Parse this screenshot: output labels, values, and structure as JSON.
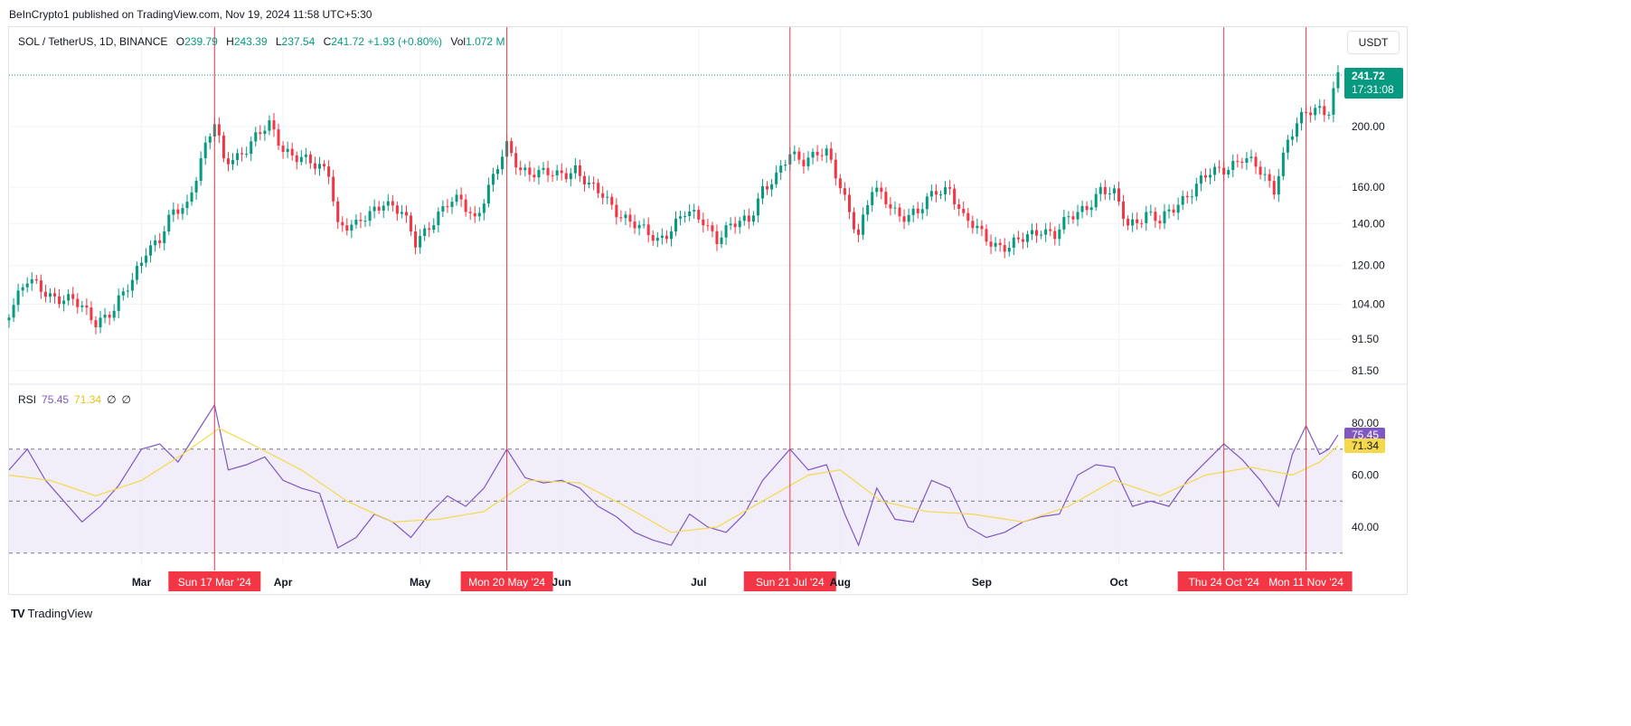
{
  "header": {
    "published_text": "BeInCrypto1 published on TradingView.com, Nov 19, 2024 11:58 UTC+5:30"
  },
  "legend": {
    "symbol": "SOL / TetherUS, 1D, BINANCE",
    "o_label": "O",
    "o": "239.79",
    "h_label": "H",
    "h": "243.39",
    "l_label": "L",
    "l": "237.54",
    "c_label": "C",
    "c": "241.72",
    "change": "+1.93 (+0.80%)",
    "vol_label": "Vol",
    "vol": "1.072 M"
  },
  "currency": "USDT",
  "last_price": {
    "price": "241.72",
    "countdown": "17:31:08"
  },
  "rsi_legend": {
    "label": "RSI",
    "rsi": "75.45",
    "ma": "71.34",
    "x1": "∅",
    "x2": "∅"
  },
  "rsi_tags": {
    "rsi": "75.45",
    "ma": "71.34"
  },
  "footer": {
    "brand": "TradingView"
  },
  "colors": {
    "up": "#089981",
    "down": "#f23645",
    "rsi": "#7e57c2",
    "rsi_ma": "#f5d84b",
    "marker": "#f23645",
    "band": "#ede7f6"
  },
  "chart_data": [
    {
      "type": "candlestick",
      "title": "SOL / TetherUS, 1D, BINANCE",
      "y_scale": "log",
      "y_ticks": [
        81.5,
        91.5,
        104.0,
        120.0,
        140.0,
        160.0,
        200.0
      ],
      "y_tick_labels": [
        "81.50",
        "91.50",
        "104.00",
        "120.00",
        "140.00",
        "160.00",
        "200.00"
      ],
      "x_tick_labels": [
        "Mar",
        "Apr",
        "May",
        "Jun",
        "Jul",
        "Aug",
        "Sep",
        "Oct"
      ],
      "x_ticks": [
        "2024-03-01",
        "2024-04-01",
        "2024-05-01",
        "2024-06-01",
        "2024-07-01",
        "2024-08-01",
        "2024-09-01",
        "2024-10-01"
      ],
      "last_price": 241.72,
      "close_path": [
        [
          "2024-02-01",
          102
        ],
        [
          "2024-02-05",
          113
        ],
        [
          "2024-02-10",
          108
        ],
        [
          "2024-02-15",
          105
        ],
        [
          "2024-02-20",
          98
        ],
        [
          "2024-02-24",
          102
        ],
        [
          "2024-02-28",
          113
        ],
        [
          "2024-03-02",
          128
        ],
        [
          "2024-03-05",
          132
        ],
        [
          "2024-03-08",
          145
        ],
        [
          "2024-03-11",
          150
        ],
        [
          "2024-03-14",
          178
        ],
        [
          "2024-03-17",
          202
        ],
        [
          "2024-03-19",
          175
        ],
        [
          "2024-03-22",
          180
        ],
        [
          "2024-03-26",
          192
        ],
        [
          "2024-03-29",
          200
        ],
        [
          "2024-04-01",
          185
        ],
        [
          "2024-04-05",
          178
        ],
        [
          "2024-04-08",
          172
        ],
        [
          "2024-04-11",
          170
        ],
        [
          "2024-04-13",
          140
        ],
        [
          "2024-04-17",
          138
        ],
        [
          "2024-04-20",
          145
        ],
        [
          "2024-04-23",
          153
        ],
        [
          "2024-04-27",
          145
        ],
        [
          "2024-04-30",
          130
        ],
        [
          "2024-05-03",
          140
        ],
        [
          "2024-05-07",
          150
        ],
        [
          "2024-05-10",
          152
        ],
        [
          "2024-05-13",
          143
        ],
        [
          "2024-05-17",
          165
        ],
        [
          "2024-05-20",
          185
        ],
        [
          "2024-05-23",
          172
        ],
        [
          "2024-05-27",
          168
        ],
        [
          "2024-05-31",
          167
        ],
        [
          "2024-06-04",
          172
        ],
        [
          "2024-06-07",
          160
        ],
        [
          "2024-06-10",
          155
        ],
        [
          "2024-06-14",
          145
        ],
        [
          "2024-06-18",
          137
        ],
        [
          "2024-06-22",
          132
        ],
        [
          "2024-06-25",
          138
        ],
        [
          "2024-06-28",
          145
        ],
        [
          "2024-07-02",
          142
        ],
        [
          "2024-07-05",
          133
        ],
        [
          "2024-07-08",
          138
        ],
        [
          "2024-07-12",
          142
        ],
        [
          "2024-07-15",
          160
        ],
        [
          "2024-07-18",
          165
        ],
        [
          "2024-07-21",
          180
        ],
        [
          "2024-07-24",
          178
        ],
        [
          "2024-07-27",
          182
        ],
        [
          "2024-07-29",
          180
        ],
        [
          "2024-08-01",
          160
        ],
        [
          "2024-08-05",
          135
        ],
        [
          "2024-08-08",
          158
        ],
        [
          "2024-08-11",
          152
        ],
        [
          "2024-08-14",
          145
        ],
        [
          "2024-08-18",
          145
        ],
        [
          "2024-08-22",
          158
        ],
        [
          "2024-08-25",
          160
        ],
        [
          "2024-08-28",
          142
        ],
        [
          "2024-09-01",
          135
        ],
        [
          "2024-09-04",
          130
        ],
        [
          "2024-09-07",
          128
        ],
        [
          "2024-09-10",
          132
        ],
        [
          "2024-09-14",
          138
        ],
        [
          "2024-09-17",
          134
        ],
        [
          "2024-09-20",
          142
        ],
        [
          "2024-09-24",
          150
        ],
        [
          "2024-09-27",
          158
        ],
        [
          "2024-09-30",
          155
        ],
        [
          "2024-10-03",
          140
        ],
        [
          "2024-10-07",
          145
        ],
        [
          "2024-10-10",
          140
        ],
        [
          "2024-10-14",
          152
        ],
        [
          "2024-10-17",
          158
        ],
        [
          "2024-10-21",
          168
        ],
        [
          "2024-10-24",
          172
        ],
        [
          "2024-10-28",
          178
        ],
        [
          "2024-10-31",
          172
        ],
        [
          "2024-11-04",
          160
        ],
        [
          "2024-11-07",
          190
        ],
        [
          "2024-11-11",
          210
        ],
        [
          "2024-11-14",
          215
        ],
        [
          "2024-11-16",
          213
        ],
        [
          "2024-11-18",
          241.72
        ]
      ]
    },
    {
      "type": "line",
      "title": "RSI",
      "y_ticks": [
        40,
        60,
        80
      ],
      "y_tick_labels": [
        "40.00",
        "60.00",
        "80.00"
      ],
      "bands": [
        30,
        50,
        70
      ],
      "series": [
        {
          "name": "RSI",
          "last": 75.45,
          "values": [
            [
              "2024-02-01",
              62
            ],
            [
              "2024-02-05",
              70
            ],
            [
              "2024-02-09",
              58
            ],
            [
              "2024-02-13",
              50
            ],
            [
              "2024-02-17",
              42
            ],
            [
              "2024-02-21",
              48
            ],
            [
              "2024-02-25",
              56
            ],
            [
              "2024-03-01",
              70
            ],
            [
              "2024-03-05",
              72
            ],
            [
              "2024-03-09",
              65
            ],
            [
              "2024-03-13",
              76
            ],
            [
              "2024-03-17",
              87
            ],
            [
              "2024-03-20",
              62
            ],
            [
              "2024-03-24",
              64
            ],
            [
              "2024-03-28",
              67
            ],
            [
              "2024-04-01",
              58
            ],
            [
              "2024-04-05",
              55
            ],
            [
              "2024-04-09",
              53
            ],
            [
              "2024-04-13",
              32
            ],
            [
              "2024-04-17",
              36
            ],
            [
              "2024-04-21",
              45
            ],
            [
              "2024-04-25",
              42
            ],
            [
              "2024-04-29",
              36
            ],
            [
              "2024-05-03",
              45
            ],
            [
              "2024-05-07",
              52
            ],
            [
              "2024-05-11",
              48
            ],
            [
              "2024-05-15",
              55
            ],
            [
              "2024-05-20",
              70
            ],
            [
              "2024-05-24",
              59
            ],
            [
              "2024-05-28",
              57
            ],
            [
              "2024-06-01",
              58
            ],
            [
              "2024-06-05",
              55
            ],
            [
              "2024-06-09",
              48
            ],
            [
              "2024-06-13",
              44
            ],
            [
              "2024-06-17",
              38
            ],
            [
              "2024-06-21",
              35
            ],
            [
              "2024-06-25",
              33
            ],
            [
              "2024-06-29",
              45
            ],
            [
              "2024-07-03",
              40
            ],
            [
              "2024-07-07",
              38
            ],
            [
              "2024-07-11",
              45
            ],
            [
              "2024-07-15",
              58
            ],
            [
              "2024-07-21",
              70
            ],
            [
              "2024-07-25",
              62
            ],
            [
              "2024-07-29",
              64
            ],
            [
              "2024-08-02",
              45
            ],
            [
              "2024-08-05",
              33
            ],
            [
              "2024-08-09",
              55
            ],
            [
              "2024-08-13",
              43
            ],
            [
              "2024-08-17",
              42
            ],
            [
              "2024-08-21",
              58
            ],
            [
              "2024-08-25",
              55
            ],
            [
              "2024-08-29",
              40
            ],
            [
              "2024-09-02",
              36
            ],
            [
              "2024-09-06",
              38
            ],
            [
              "2024-09-10",
              42
            ],
            [
              "2024-09-14",
              44
            ],
            [
              "2024-09-18",
              45
            ],
            [
              "2024-09-22",
              60
            ],
            [
              "2024-09-26",
              64
            ],
            [
              "2024-09-30",
              63
            ],
            [
              "2024-10-04",
              48
            ],
            [
              "2024-10-08",
              50
            ],
            [
              "2024-10-12",
              48
            ],
            [
              "2024-10-16",
              58
            ],
            [
              "2024-10-20",
              65
            ],
            [
              "2024-10-24",
              72
            ],
            [
              "2024-10-28",
              66
            ],
            [
              "2024-11-01",
              58
            ],
            [
              "2024-11-05",
              48
            ],
            [
              "2024-11-08",
              68
            ],
            [
              "2024-11-11",
              79
            ],
            [
              "2024-11-14",
              68
            ],
            [
              "2024-11-16",
              70
            ],
            [
              "2024-11-18",
              75.45
            ]
          ]
        },
        {
          "name": "RSI-based MA",
          "last": 71.34,
          "values": [
            [
              "2024-02-01",
              60
            ],
            [
              "2024-02-10",
              58
            ],
            [
              "2024-02-20",
              52
            ],
            [
              "2024-03-01",
              58
            ],
            [
              "2024-03-10",
              68
            ],
            [
              "2024-03-18",
              78
            ],
            [
              "2024-03-25",
              72
            ],
            [
              "2024-04-05",
              62
            ],
            [
              "2024-04-15",
              50
            ],
            [
              "2024-04-25",
              42
            ],
            [
              "2024-05-05",
              43
            ],
            [
              "2024-05-15",
              46
            ],
            [
              "2024-05-25",
              58
            ],
            [
              "2024-06-05",
              57
            ],
            [
              "2024-06-15",
              48
            ],
            [
              "2024-06-25",
              38
            ],
            [
              "2024-07-05",
              40
            ],
            [
              "2024-07-15",
              50
            ],
            [
              "2024-07-25",
              60
            ],
            [
              "2024-08-01",
              62
            ],
            [
              "2024-08-10",
              50
            ],
            [
              "2024-08-20",
              46
            ],
            [
              "2024-08-30",
              45
            ],
            [
              "2024-09-10",
              42
            ],
            [
              "2024-09-20",
              48
            ],
            [
              "2024-09-30",
              58
            ],
            [
              "2024-10-10",
              52
            ],
            [
              "2024-10-20",
              60
            ],
            [
              "2024-10-30",
              63
            ],
            [
              "2024-11-08",
              60
            ],
            [
              "2024-11-14",
              65
            ],
            [
              "2024-11-18",
              71.34
            ]
          ]
        }
      ]
    }
  ],
  "markers": [
    {
      "date": "2024-03-17",
      "label": "Sun 17 Mar '24"
    },
    {
      "date": "2024-05-20",
      "label": "Mon 20 May '24"
    },
    {
      "date": "2024-07-21",
      "label": "Sun 21 Jul '24"
    },
    {
      "date": "2024-10-24",
      "label": "Thu 24 Oct '24"
    },
    {
      "date": "2024-11-11",
      "label": "Mon 11 Nov '24"
    }
  ]
}
